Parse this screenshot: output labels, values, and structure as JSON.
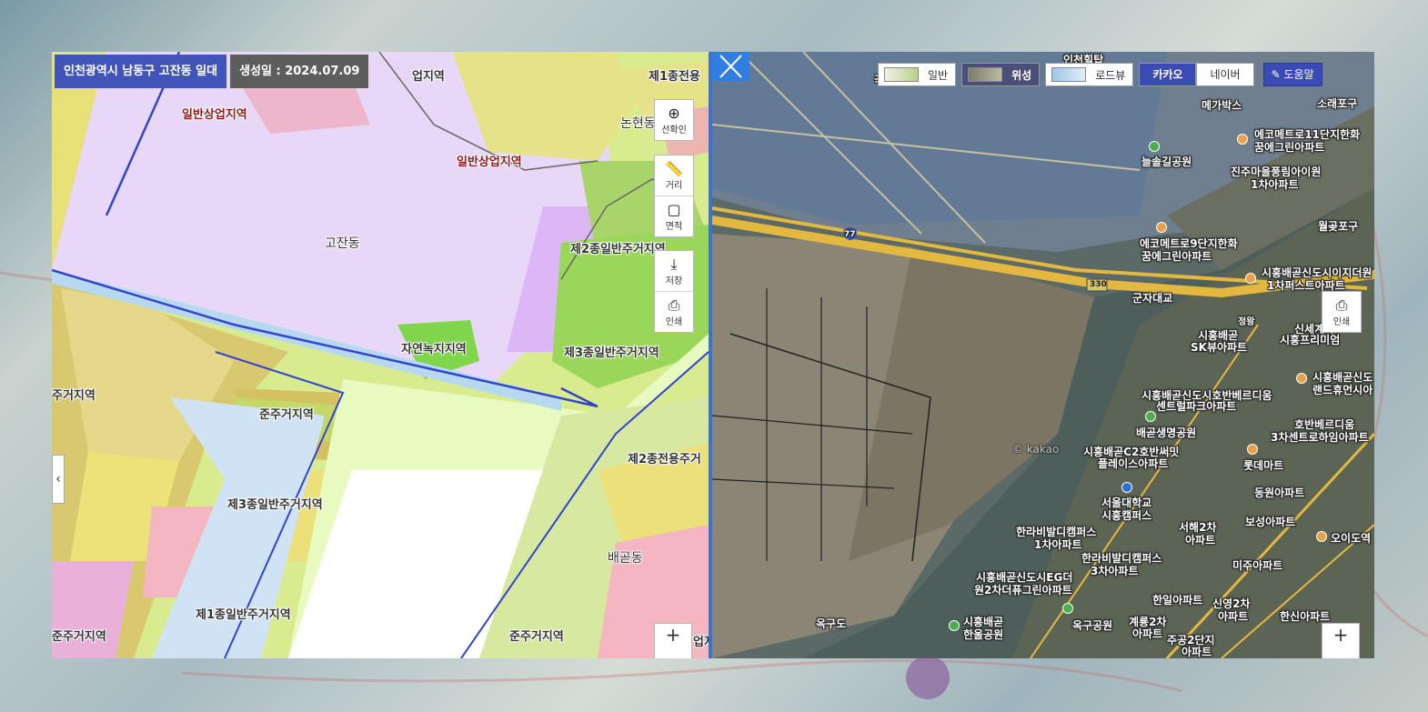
{
  "header": {
    "location": "인천광역시 남동구 고잔동 일대",
    "created": "생성일 : 2024.07.09"
  },
  "tools": {
    "zoom_select": "선확인",
    "distance": "거리",
    "area": "면적",
    "save": "저장",
    "print": "인쇄",
    "zoom_in": "+"
  },
  "left_map": {
    "labels": [
      "일반상업지역",
      "일반상업지역",
      "고잔동",
      "제2종일반주거지역",
      "자연녹지지역",
      "제3종일반주거지역",
      "준주거지역",
      "제3종일반주거지역",
      "제1종일반주거지역",
      "준주거지역",
      "제2종전용주거",
      "배곧동",
      "논현동",
      "제1종전용",
      "준주거지역",
      "주거지역",
      "업지역",
      "업지"
    ]
  },
  "right_map": {
    "map_types": {
      "general": "일반",
      "satellite": "위성",
      "roadview": "로드뷰"
    },
    "providers": {
      "kakao": "카카오",
      "naver": "네이버"
    },
    "help": "도움말",
    "print": "인쇄",
    "zoom_in": "+",
    "labels": [
      "인천힐탑",
      "국가",
      "메가박스",
      "소래포구",
      "에코메트로11단지한화",
      "꿈에그린아파트",
      "늘솔길공원",
      "진주마을풍림아이원",
      "1차아파트",
      "월곶포구",
      "에코메트로9단지한화",
      "꿈에그린아파트",
      "시흥배곧신도시이지더원",
      "1차퍼스트아파트",
      "군자대교",
      "정왕",
      "신세계아",
      "시흥프리미엄",
      "시흥배곧",
      "SK뷰아파트",
      "시흥배곧신도",
      "랜드휴먼시아",
      "시흥배곧신도시호반베르디움",
      "센트럴파크아파트",
      "배곧생명공원",
      "호반베르디움",
      "3차센트로하임아파트",
      "시흥배곧C2호반써밋",
      "플레이스아파트",
      "롯데마트",
      "서울대학교",
      "시흥캠퍼스",
      "동원아파트",
      "한라비발디캠퍼스",
      "1차아파트",
      "서해2차",
      "아파트",
      "보성아파트",
      "오이도역",
      "한라비발디캠퍼스",
      "3차아파트",
      "미주아파트",
      "시흥배곧신도시EG더",
      "원2차더퓨그린아파트",
      "한일아파트",
      "신영2차",
      "아파트",
      "한신아파트",
      "옥구도",
      "옥구공원",
      "계룡2차",
      "아파트",
      "시흥배곧",
      "한울공원",
      "주공2단지",
      "아파트"
    ],
    "road_numbers": [
      "77",
      "330"
    ],
    "watermark": "© kakao"
  }
}
